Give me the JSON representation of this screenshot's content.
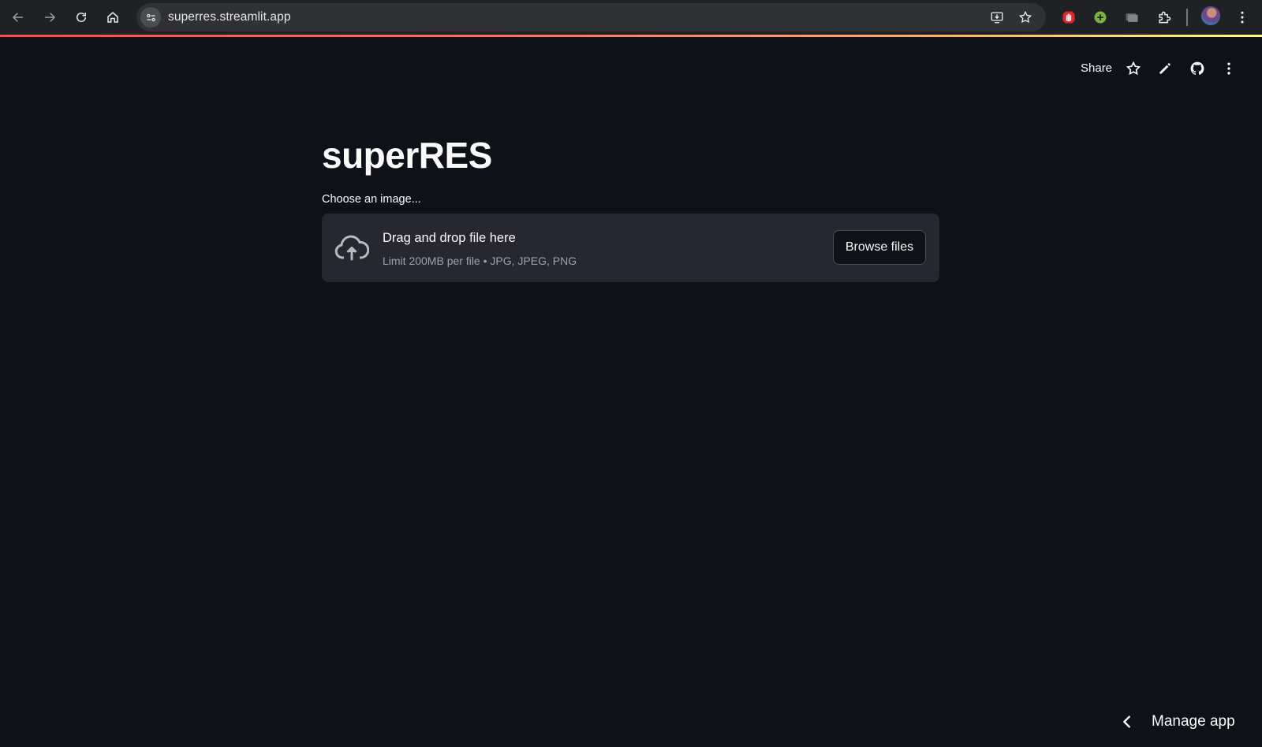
{
  "browser": {
    "url": "superres.streamlit.app",
    "icons": {
      "back": "back-arrow-icon",
      "forward": "forward-arrow-icon",
      "reload": "reload-icon",
      "home": "home-icon",
      "site_info": "site-settings-icon",
      "install": "install-app-icon",
      "bookmark": "star-icon",
      "extensions": [
        "red-hand-extension-icon",
        "green-plus-extension-icon",
        "gray-folder-extension-icon",
        "puzzle-extensions-icon"
      ],
      "profile": "avatar",
      "menu": "kebab-menu-icon"
    },
    "accent_gradient": [
      "#ff4b4b",
      "#fffd80"
    ]
  },
  "toolbar": {
    "share_label": "Share",
    "icons": [
      "star-icon",
      "pencil-icon",
      "github-icon",
      "kebab-menu-icon"
    ]
  },
  "main": {
    "title": "superRES",
    "uploader": {
      "label": "Choose an image...",
      "drop_text": "Drag and drop file here",
      "limit_text": "Limit 200MB per file • JPG, JPEG, PNG",
      "browse_label": "Browse files",
      "icon": "cloud-upload-icon"
    }
  },
  "footer": {
    "manage_label": "Manage app",
    "icon": "chevron-left-icon"
  },
  "colors": {
    "background": "#0e1117",
    "surface": "#262730",
    "chrome": "#202124",
    "text": "#fafafa",
    "muted_text": "#9da2ad"
  }
}
